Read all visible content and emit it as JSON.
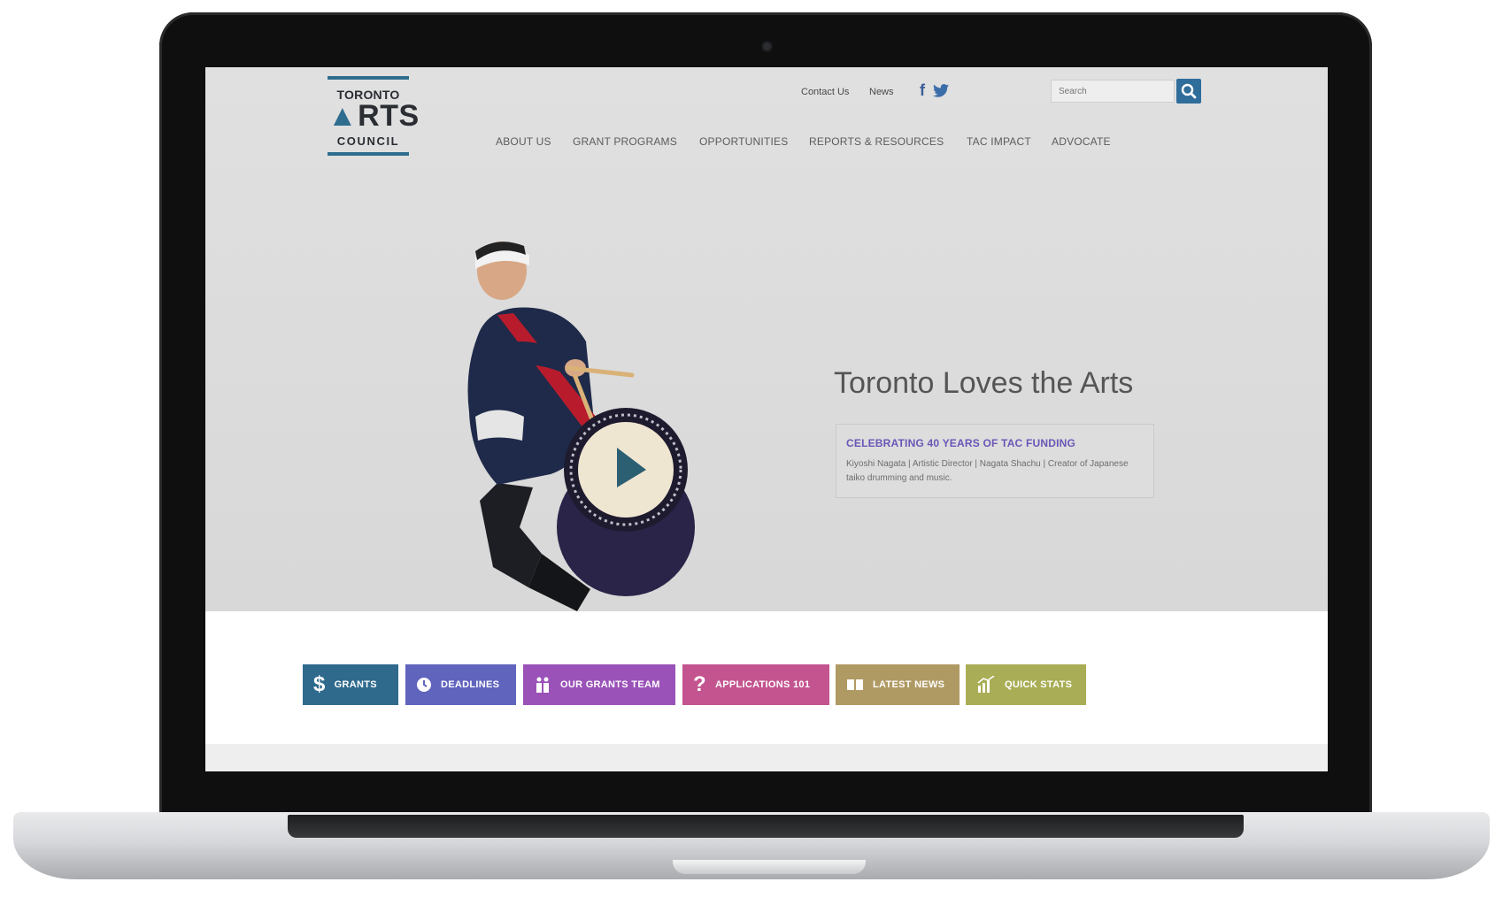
{
  "logo": {
    "line1": "TORONTO",
    "line2_mark": "▲",
    "line2_rest": "RTS",
    "line3": "COUNCIL"
  },
  "utility_nav": {
    "contact": "Contact Us",
    "news": "News",
    "facebook": "f",
    "twitter": "twitter-icon"
  },
  "search": {
    "placeholder": "Search"
  },
  "main_nav": [
    "ABOUT US",
    "GRANT PROGRAMS",
    "OPPORTUNITIES",
    "REPORTS & RESOURCES",
    "TAC IMPACT",
    "ADVOCATE"
  ],
  "hero": {
    "title": "Toronto Loves the Arts",
    "callout_heading": "CELEBRATING 40 YEARS OF TAC FUNDING",
    "callout_text": "Kiyoshi Nagata | Artistic Director | Nagata Shachu | Creator of Japanese taiko drumming and music."
  },
  "quick_links": [
    {
      "label": "GRANTS",
      "color": "#2f6a8c",
      "icon": "dollar-icon"
    },
    {
      "label": "DEADLINES",
      "color": "#6064bd",
      "icon": "clock-icon"
    },
    {
      "label": "OUR GRANTS TEAM",
      "color": "#9a52b8",
      "icon": "people-icon"
    },
    {
      "label": "APPLICATIONS 101",
      "color": "#c3548f",
      "icon": "question-icon"
    },
    {
      "label": "LATEST NEWS",
      "color": "#b09a63",
      "icon": "book-icon"
    },
    {
      "label": "QUICK STATS",
      "color": "#a9ad55",
      "icon": "chart-icon"
    }
  ],
  "colors": {
    "accent_blue": "#2f6d9a",
    "callout_purple": "#6a56b6"
  }
}
